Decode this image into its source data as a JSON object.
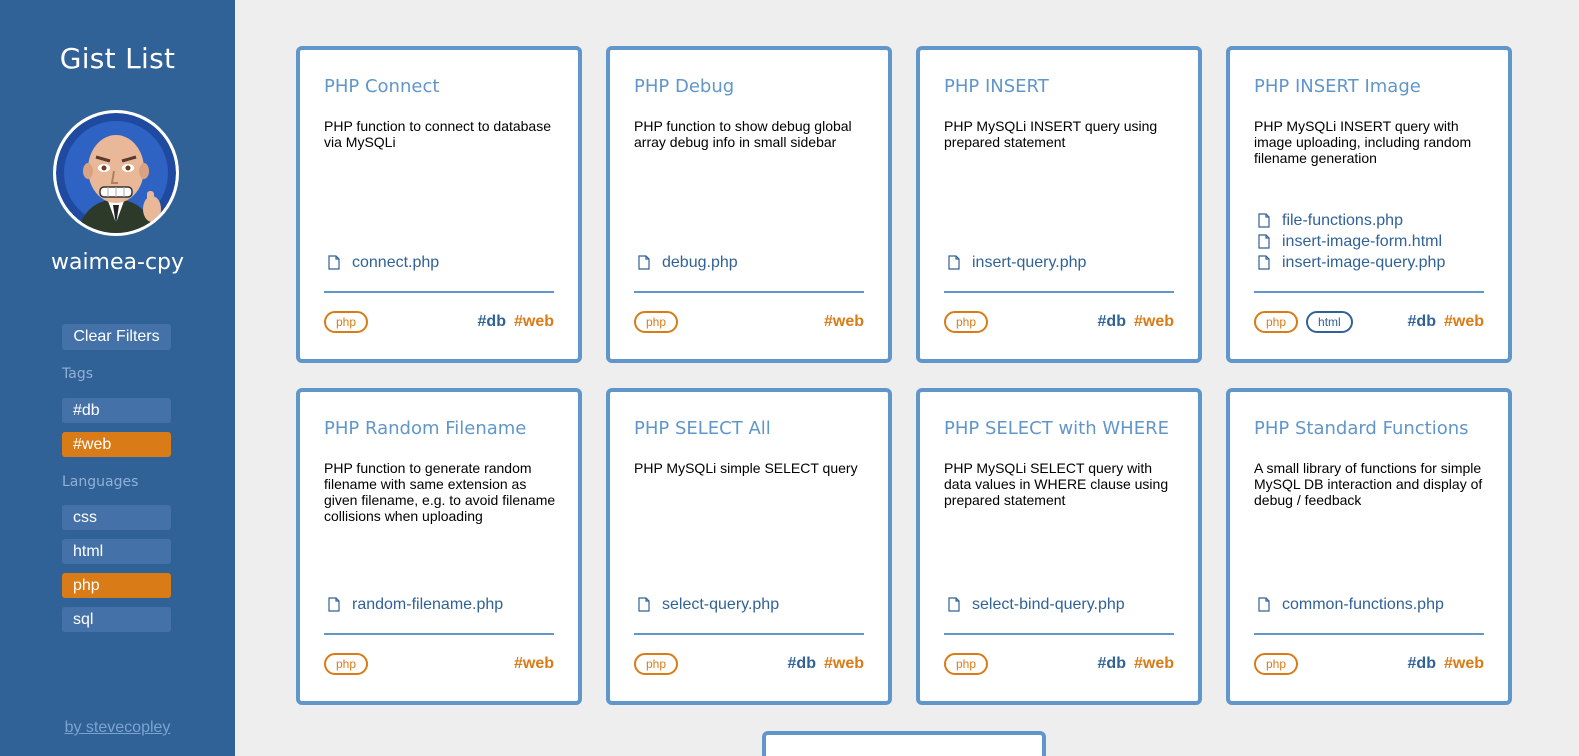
{
  "sidebar": {
    "title": "Gist List",
    "username": "waimea-cpy",
    "clear_filters": "Clear Filters",
    "tags_label": "Tags",
    "tags": [
      {
        "label": "#db",
        "active": false
      },
      {
        "label": "#web",
        "active": true
      }
    ],
    "languages_label": "Languages",
    "languages": [
      {
        "label": "css",
        "active": false
      },
      {
        "label": "html",
        "active": false
      },
      {
        "label": "php",
        "active": true
      },
      {
        "label": "sql",
        "active": false
      }
    ],
    "by_link": "by stevecopley"
  },
  "colors": {
    "sidebar_bg": "#316297",
    "accent_blue": "#6196cb",
    "accent_orange": "#d97b17",
    "page_bg": "#eeeeee"
  },
  "cards": [
    {
      "title": "PHP Connect",
      "description": "PHP function to connect to database via MySQLi",
      "files": [
        "connect.php"
      ],
      "languages": [
        "php"
      ],
      "tags": [
        "#db",
        "#web"
      ]
    },
    {
      "title": "PHP Debug",
      "description": "PHP function to show debug global array debug info in small sidebar",
      "files": [
        "debug.php"
      ],
      "languages": [
        "php"
      ],
      "tags": [
        "#web"
      ]
    },
    {
      "title": "PHP INSERT",
      "description": "PHP MySQLi INSERT query using prepared statement",
      "files": [
        "insert-query.php"
      ],
      "languages": [
        "php"
      ],
      "tags": [
        "#db",
        "#web"
      ]
    },
    {
      "title": "PHP INSERT Image",
      "description": "PHP MySQLi INSERT query with image uploading, including random filename generation",
      "files": [
        "file-functions.php",
        "insert-image-form.html",
        "insert-image-query.php"
      ],
      "languages": [
        "php",
        "html"
      ],
      "tags": [
        "#db",
        "#web"
      ]
    },
    {
      "title": "PHP Random Filename",
      "description": "PHP function to generate random filename with same extension as given filename, e.g. to avoid filename collisions when uploading",
      "files": [
        "random-filename.php"
      ],
      "languages": [
        "php"
      ],
      "tags": [
        "#web"
      ]
    },
    {
      "title": "PHP SELECT All",
      "description": "PHP MySQLi simple SELECT query",
      "files": [
        "select-query.php"
      ],
      "languages": [
        "php"
      ],
      "tags": [
        "#db",
        "#web"
      ]
    },
    {
      "title": "PHP SELECT with WHERE",
      "description": "PHP MySQLi SELECT query with data values in WHERE clause using prepared statement",
      "files": [
        "select-bind-query.php"
      ],
      "languages": [
        "php"
      ],
      "tags": [
        "#db",
        "#web"
      ]
    },
    {
      "title": "PHP Standard Functions",
      "description": "A small library of functions for simple MySQL DB interaction and display of debug / feedback",
      "files": [
        "common-functions.php"
      ],
      "languages": [
        "php"
      ],
      "tags": [
        "#db",
        "#web"
      ]
    }
  ]
}
